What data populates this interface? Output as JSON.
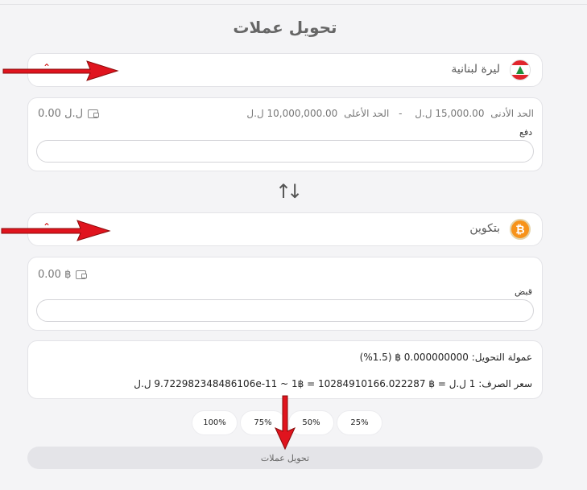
{
  "page": {
    "title": "تحويل عملات"
  },
  "from": {
    "currency_name": "ليرة لبنانية",
    "currency_icon": "lebanon-flag-icon",
    "min_label": "الحد الأدنى",
    "min_value": "15,000.00 ل.ل",
    "separator": "-",
    "max_label": "الحد الأعلى",
    "max_value": "10,000,000.00 ل.ل",
    "balance": "0.00 ل.ل",
    "field_label": "دفع",
    "field_value": ""
  },
  "to": {
    "currency_name": "بتكوين",
    "currency_icon": "bitcoin-icon",
    "coin_glyph": "₿",
    "balance": "0.00 ฿",
    "field_label": "قبض",
    "field_value": ""
  },
  "info": {
    "commission": "عمولة التحويل: 0.000000000 ฿ (1.5%)",
    "rate": "سعر الصرف: 1 ل.ل = ฿ 9.722982348486106e-11 ~ 1฿ = 10284910166.022287 ل.ل"
  },
  "percent_buttons": [
    "100%",
    "75%",
    "50%",
    "25%"
  ],
  "convert_button": "تحويل عملات",
  "colors": {
    "annotation_arrow": "#e0141e",
    "bitcoin": "#f7931a",
    "lebanon_red": "#e1262d",
    "lebanon_green": "#1f8f3a"
  }
}
